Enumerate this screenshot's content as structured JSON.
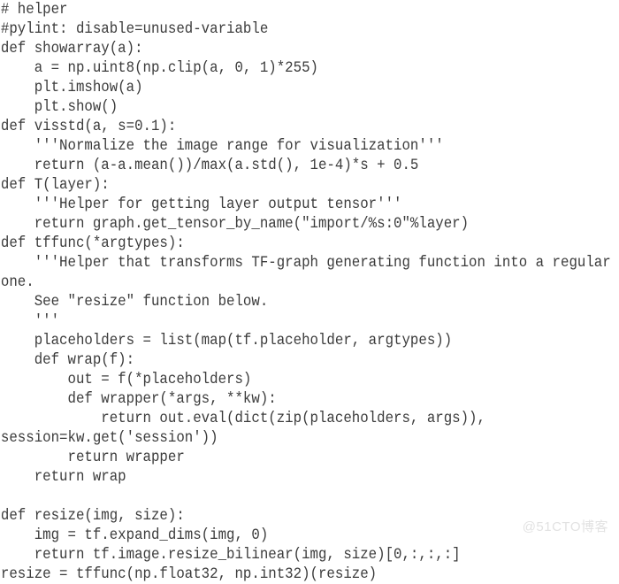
{
  "page": {
    "title": "helper code snippet",
    "background_color": "#ffffff",
    "text_color": "#3b3b3b",
    "language": "python"
  },
  "code": {
    "lines": [
      "# helper",
      "#pylint: disable=unused-variable",
      "def showarray(a):",
      "    a = np.uint8(np.clip(a, 0, 1)*255)",
      "    plt.imshow(a)",
      "    plt.show()",
      "def visstd(a, s=0.1):",
      "    '''Normalize the image range for visualization'''",
      "    return (a-a.mean())/max(a.std(), 1e-4)*s + 0.5",
      "def T(layer):",
      "    '''Helper for getting layer output tensor'''",
      "    return graph.get_tensor_by_name(\"import/%s:0\"%layer)",
      "def tffunc(*argtypes):",
      "    '''Helper that transforms TF-graph generating function into a regular",
      "one.",
      "    See \"resize\" function below.",
      "    '''",
      "    placeholders = list(map(tf.placeholder, argtypes))",
      "    def wrap(f):",
      "        out = f(*placeholders)",
      "        def wrapper(*args, **kw):",
      "            return out.eval(dict(zip(placeholders, args)),",
      "session=kw.get('session'))",
      "        return wrapper",
      "    return wrap",
      "",
      "def resize(img, size):",
      "    img = tf.expand_dims(img, 0)",
      "    return tf.image.resize_bilinear(img, size)[0,:,:,:]",
      "resize = tffunc(np.float32, np.int32)(resize)"
    ]
  },
  "watermark": {
    "text": "@51CTO博客",
    "color": "#e2e2e2"
  }
}
